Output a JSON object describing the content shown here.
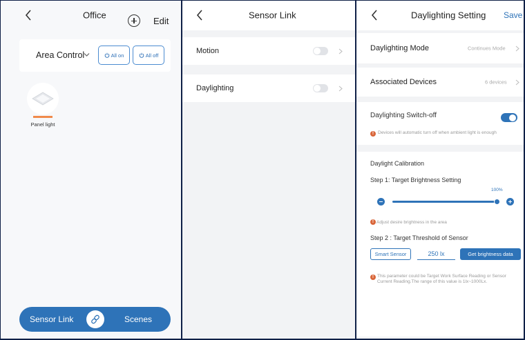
{
  "office_screen": {
    "title": "Office",
    "edit_label": "Edit",
    "area_label": "Area Control",
    "all_on_label": "All on",
    "all_off_label": "All off",
    "device_name": "Panel light",
    "bottom_left_label": "Sensor Link",
    "bottom_right_label": "Scenes"
  },
  "sensor_link_screen": {
    "title": "Sensor Link",
    "rows": [
      {
        "label": "Motion",
        "enabled": false
      },
      {
        "label": "Daylighting",
        "enabled": false
      }
    ]
  },
  "daylighting_screen": {
    "title": "Daylighting Setting",
    "save_label": "Save",
    "mode_label": "Daylighting Mode",
    "mode_value": "Continues Mode",
    "devices_label": "Associated Devices",
    "devices_value": "6 devices",
    "switchoff_label": "Daylighting Switch-off",
    "switchoff_enabled": true,
    "switchoff_note": "Devices will automatic turn off when ambient light is enough",
    "calibration_title": "Daylight Calibration",
    "step1_label": "Step 1: Target Brightness Setting",
    "brightness_value": "100%",
    "brightness_percent": 100,
    "step1_note": "Adjust desire brightness in the area",
    "step2_label": "Step 2 : Target Threshold of Sensor",
    "smart_sensor_label": "Smart Sensor",
    "threshold_value": "250",
    "threshold_unit": "lx",
    "get_data_label": "Get brightness data",
    "step2_note": "This parameter could be Target Work Surface Reading or Sensor Current Reading.The range of this value is 1lx~1000Lx."
  },
  "colors": {
    "accent": "#2e73b8",
    "indicator": "#f08a4b",
    "warning": "#d9663a",
    "frame": "#0e1f46"
  }
}
